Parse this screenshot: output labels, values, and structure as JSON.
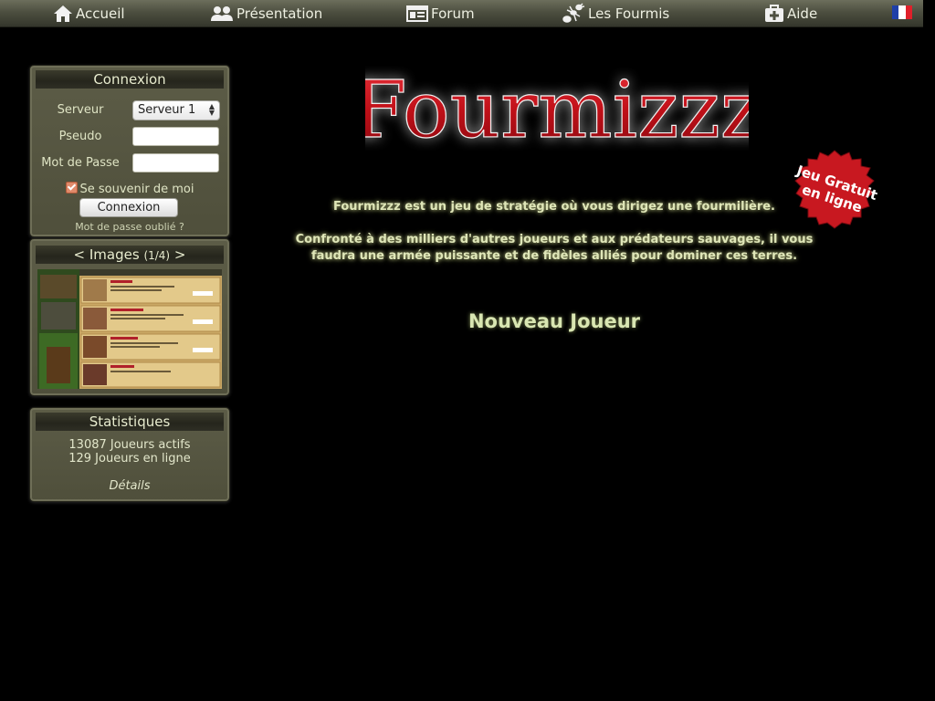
{
  "nav": {
    "items": [
      {
        "label": "Accueil",
        "icon": "home-icon"
      },
      {
        "label": "Présentation",
        "icon": "users-icon"
      },
      {
        "label": "Forum",
        "icon": "forum-icon"
      },
      {
        "label": "Les Fourmis",
        "icon": "ant-icon"
      },
      {
        "label": "Aide",
        "icon": "medkit-icon"
      }
    ],
    "language_flag": "flag-fr-icon"
  },
  "login": {
    "title": "Connexion",
    "server_label": "Serveur",
    "server_value": "Serveur 1",
    "pseudo_label": "Pseudo",
    "password_label": "Mot de Passe",
    "remember_label": "Se souvenir de moi",
    "remember_checked": true,
    "submit_label": "Connexion",
    "forgot_label": "Mot de passe oublié ?"
  },
  "images": {
    "prev": "<",
    "title": "Images",
    "counter": "(1/4)",
    "next": ">"
  },
  "stats": {
    "title": "Statistiques",
    "active_players": "13087 Joueurs actifs",
    "online_players": "129 Joueurs en ligne",
    "details_label": "Détails"
  },
  "main": {
    "logo_text": "Fourmizzz",
    "badge_line1": "Jeu Gratuit",
    "badge_line2": "en ligne",
    "intro_1": "Fourmizzz est un jeu de stratégie où vous dirigez une fourmilière.",
    "intro_2a": "Confronté à des milliers d'autres joueurs et aux prédateurs sauvages, il vous",
    "intro_2b": "faudra une armée puissante et de fidèles alliés pour dominer ces terres.",
    "new_player": "Nouveau Joueur"
  },
  "colors": {
    "background": "#000000",
    "nav_bar": "#4d4f40",
    "panel": "#55553f",
    "logo_red": "#c8141e",
    "text_glow": "#dfe6b8"
  }
}
